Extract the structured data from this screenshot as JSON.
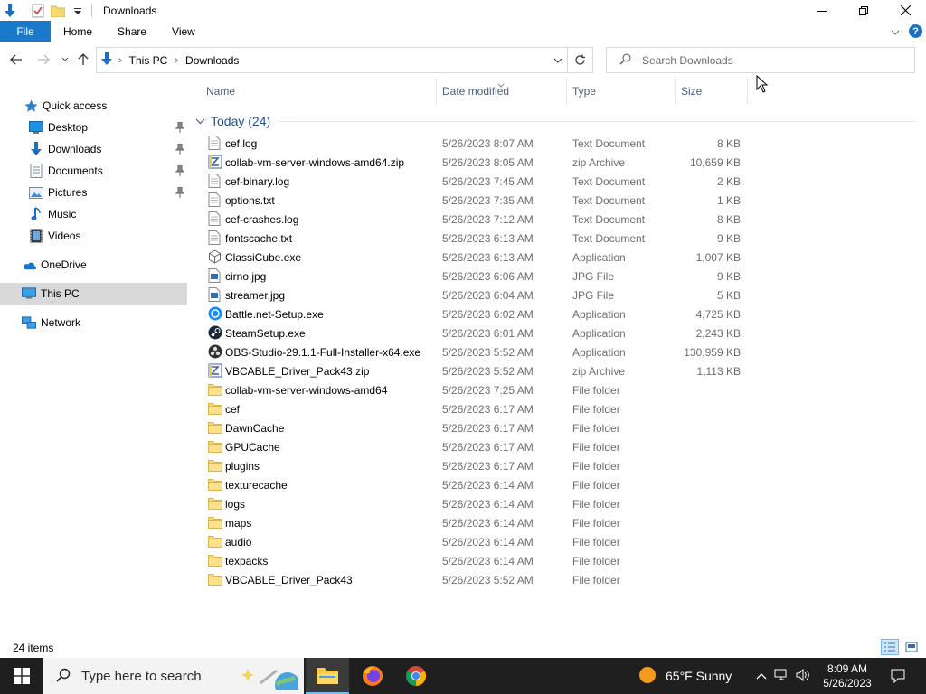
{
  "window": {
    "title": "Downloads"
  },
  "ribbon": {
    "tabs": [
      "File",
      "Home",
      "Share",
      "View"
    ],
    "help": "?"
  },
  "address": {
    "crumbs": [
      "This PC",
      "Downloads"
    ]
  },
  "search": {
    "placeholder": "Search Downloads"
  },
  "sidebar": {
    "items": [
      {
        "label": "Quick access",
        "icon": "star-icon"
      },
      {
        "label": "Desktop",
        "icon": "desktop-icon",
        "pinned": true
      },
      {
        "label": "Downloads",
        "icon": "download-icon",
        "pinned": true
      },
      {
        "label": "Documents",
        "icon": "documents-icon",
        "pinned": true
      },
      {
        "label": "Pictures",
        "icon": "pictures-icon",
        "pinned": true
      },
      {
        "label": "Music",
        "icon": "music-icon"
      },
      {
        "label": "Videos",
        "icon": "videos-icon"
      },
      {
        "label": "OneDrive",
        "icon": "cloud-icon"
      },
      {
        "label": "This PC",
        "icon": "computer-icon",
        "selected": true
      },
      {
        "label": "Network",
        "icon": "network-icon"
      }
    ]
  },
  "columns": {
    "name": "Name",
    "date": "Date modified",
    "type": "Type",
    "size": "Size"
  },
  "group": {
    "label": "Today (24)"
  },
  "files": [
    {
      "name": "cef.log",
      "date": "5/26/2023 8:07 AM",
      "type": "Text Document",
      "size": "8 KB",
      "icon": "text"
    },
    {
      "name": "collab-vm-server-windows-amd64.zip",
      "date": "5/26/2023 8:05 AM",
      "type": "zip Archive",
      "size": "10,659 KB",
      "icon": "zip"
    },
    {
      "name": "cef-binary.log",
      "date": "5/26/2023 7:45 AM",
      "type": "Text Document",
      "size": "2 KB",
      "icon": "text"
    },
    {
      "name": "options.txt",
      "date": "5/26/2023 7:35 AM",
      "type": "Text Document",
      "size": "1 KB",
      "icon": "text"
    },
    {
      "name": "cef-crashes.log",
      "date": "5/26/2023 7:12 AM",
      "type": "Text Document",
      "size": "8 KB",
      "icon": "text"
    },
    {
      "name": "fontscache.txt",
      "date": "5/26/2023 6:13 AM",
      "type": "Text Document",
      "size": "9 KB",
      "icon": "text"
    },
    {
      "name": "ClassiCube.exe",
      "date": "5/26/2023 6:13 AM",
      "type": "Application",
      "size": "1,007 KB",
      "icon": "cube"
    },
    {
      "name": "cirno.jpg",
      "date": "5/26/2023 6:06 AM",
      "type": "JPG File",
      "size": "9 KB",
      "icon": "image"
    },
    {
      "name": "streamer.jpg",
      "date": "5/26/2023 6:04 AM",
      "type": "JPG File",
      "size": "5 KB",
      "icon": "image"
    },
    {
      "name": "Battle.net-Setup.exe",
      "date": "5/26/2023 6:02 AM",
      "type": "Application",
      "size": "4,725 KB",
      "icon": "battlenet"
    },
    {
      "name": "SteamSetup.exe",
      "date": "5/26/2023 6:01 AM",
      "type": "Application",
      "size": "2,243 KB",
      "icon": "steam"
    },
    {
      "name": "OBS-Studio-29.1.1-Full-Installer-x64.exe",
      "date": "5/26/2023 5:52 AM",
      "type": "Application",
      "size": "130,959 KB",
      "icon": "obs"
    },
    {
      "name": "VBCABLE_Driver_Pack43.zip",
      "date": "5/26/2023 5:52 AM",
      "type": "zip Archive",
      "size": "1,113 KB",
      "icon": "zip"
    },
    {
      "name": "collab-vm-server-windows-amd64",
      "date": "5/26/2023 7:25 AM",
      "type": "File folder",
      "size": "",
      "icon": "folder"
    },
    {
      "name": "cef",
      "date": "5/26/2023 6:17 AM",
      "type": "File folder",
      "size": "",
      "icon": "folder"
    },
    {
      "name": "DawnCache",
      "date": "5/26/2023 6:17 AM",
      "type": "File folder",
      "size": "",
      "icon": "folder"
    },
    {
      "name": "GPUCache",
      "date": "5/26/2023 6:17 AM",
      "type": "File folder",
      "size": "",
      "icon": "folder"
    },
    {
      "name": "plugins",
      "date": "5/26/2023 6:17 AM",
      "type": "File folder",
      "size": "",
      "icon": "folder"
    },
    {
      "name": "texturecache",
      "date": "5/26/2023 6:14 AM",
      "type": "File folder",
      "size": "",
      "icon": "folder"
    },
    {
      "name": "logs",
      "date": "5/26/2023 6:14 AM",
      "type": "File folder",
      "size": "",
      "icon": "folder"
    },
    {
      "name": "maps",
      "date": "5/26/2023 6:14 AM",
      "type": "File folder",
      "size": "",
      "icon": "folder"
    },
    {
      "name": "audio",
      "date": "5/26/2023 6:14 AM",
      "type": "File folder",
      "size": "",
      "icon": "folder"
    },
    {
      "name": "texpacks",
      "date": "5/26/2023 6:14 AM",
      "type": "File folder",
      "size": "",
      "icon": "folder"
    },
    {
      "name": "VBCABLE_Driver_Pack43",
      "date": "5/26/2023 5:52 AM",
      "type": "File folder",
      "size": "",
      "icon": "folder"
    }
  ],
  "status": {
    "count": "24 items"
  },
  "taskbar": {
    "search_placeholder": "Type here to search",
    "weather": "65°F  Sunny",
    "time": "8:09 AM",
    "date": "5/26/2023"
  },
  "colors": {
    "accent": "#1979ca",
    "group_text": "#1f4e99",
    "header_text": "#4c607a",
    "secondary_text": "#6d6d6d",
    "folder": "#f8d775",
    "taskbar": "#1f1f1f"
  }
}
